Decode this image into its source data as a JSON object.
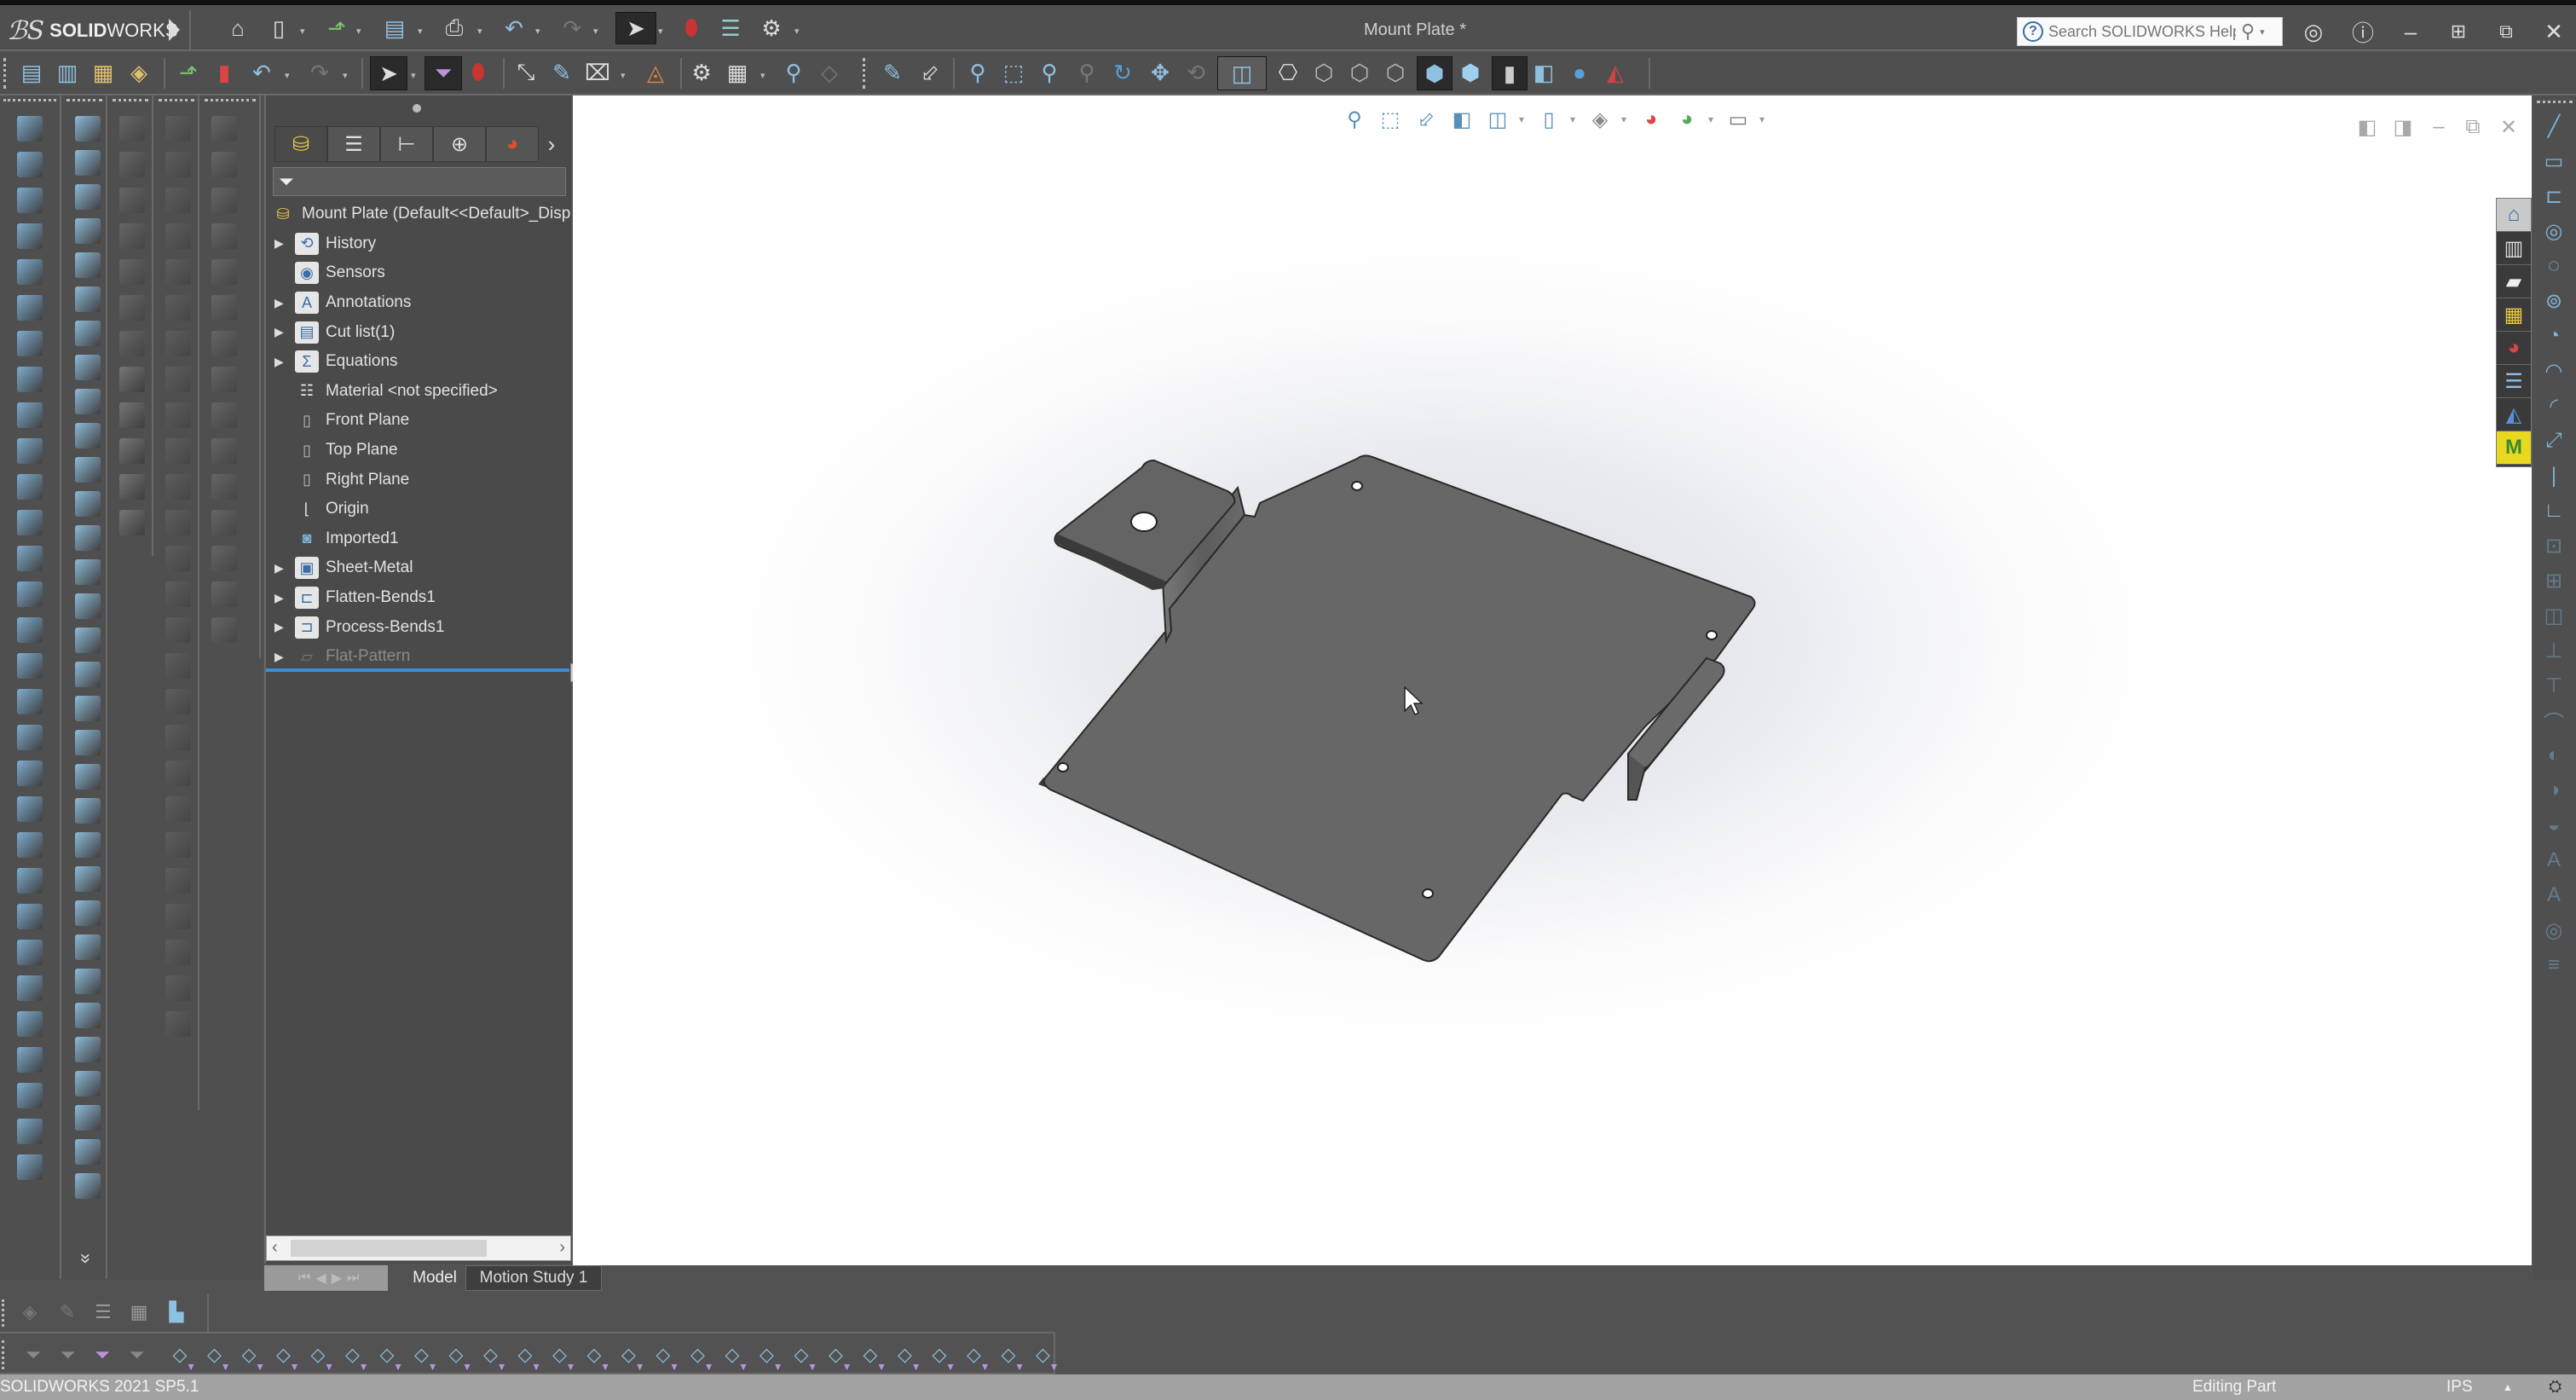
{
  "app": {
    "brand_prefix": "SOLID",
    "brand_suffix": "WORKS",
    "window_title": "Mount Plate *",
    "help_search_placeholder": "Search SOLIDWORKS Help"
  },
  "title_toolbar": {
    "icons": [
      "home-icon",
      "new-document-icon",
      "open-icon",
      "save-icon",
      "print-icon",
      "undo-icon",
      "redo-icon",
      "select-icon",
      "rebuild-icon",
      "file-properties-icon",
      "options-icon"
    ]
  },
  "window_controls": [
    "user-account-icon",
    "help-icon",
    "minimize-icon",
    "tile-icon",
    "restore-icon",
    "close-icon"
  ],
  "feature_manager": {
    "tabs": [
      "featuremanager-tab",
      "propertymanager-tab",
      "configurationmanager-tab",
      "dimxpertmanager-tab",
      "displaymanager-tab"
    ],
    "root": {
      "label": "Mount Plate  (Default<<Default>_Disp",
      "icon": "part-icon"
    },
    "items": [
      {
        "label": "History",
        "icon": "history-folder-icon",
        "expandable": true,
        "dim": false
      },
      {
        "label": "Sensors",
        "icon": "sensors-folder-icon",
        "expandable": false,
        "dim": false
      },
      {
        "label": "Annotations",
        "icon": "annotations-folder-icon",
        "expandable": true,
        "dim": false
      },
      {
        "label": "Cut list(1)",
        "icon": "cut-list-icon",
        "expandable": true,
        "dim": false
      },
      {
        "label": "Equations",
        "icon": "equations-folder-icon",
        "expandable": true,
        "dim": false
      },
      {
        "label": "Material <not specified>",
        "icon": "material-icon",
        "expandable": false,
        "dim": false
      },
      {
        "label": "Front Plane",
        "icon": "plane-icon",
        "expandable": false,
        "dim": false
      },
      {
        "label": "Top Plane",
        "icon": "plane-icon",
        "expandable": false,
        "dim": false
      },
      {
        "label": "Right Plane",
        "icon": "plane-icon",
        "expandable": false,
        "dim": false
      },
      {
        "label": "Origin",
        "icon": "origin-icon",
        "expandable": false,
        "dim": false
      },
      {
        "label": "Imported1",
        "icon": "imported-body-icon",
        "expandable": false,
        "dim": false
      },
      {
        "label": "Sheet-Metal",
        "icon": "sheet-metal-icon",
        "expandable": true,
        "dim": false
      },
      {
        "label": "Flatten-Bends1",
        "icon": "flatten-bends-icon",
        "expandable": true,
        "dim": false
      },
      {
        "label": "Process-Bends1",
        "icon": "process-bends-icon",
        "expandable": true,
        "dim": false
      },
      {
        "label": "Flat-Pattern",
        "icon": "flat-pattern-icon",
        "expandable": true,
        "dim": true
      }
    ]
  },
  "bottom_tabs": {
    "model": "Model",
    "motion_study": "Motion Study 1"
  },
  "task_pane": [
    "solidworks-resources-icon",
    "design-library-icon",
    "file-explorer-icon",
    "view-palette-icon",
    "appearances-icon",
    "custom-properties-icon",
    "solidworks-forum-icon",
    "mycadtools-icon"
  ],
  "status_bar": {
    "version": "SOLIDWORKS 2021 SP5.1",
    "mode": "Editing Part",
    "units": "IPS"
  },
  "colors": {
    "ui_dark": "#4f4f4f",
    "accent_blue": "#3c8fd4",
    "part_gray": "#666666",
    "status_bar": "#a3a3a3"
  }
}
